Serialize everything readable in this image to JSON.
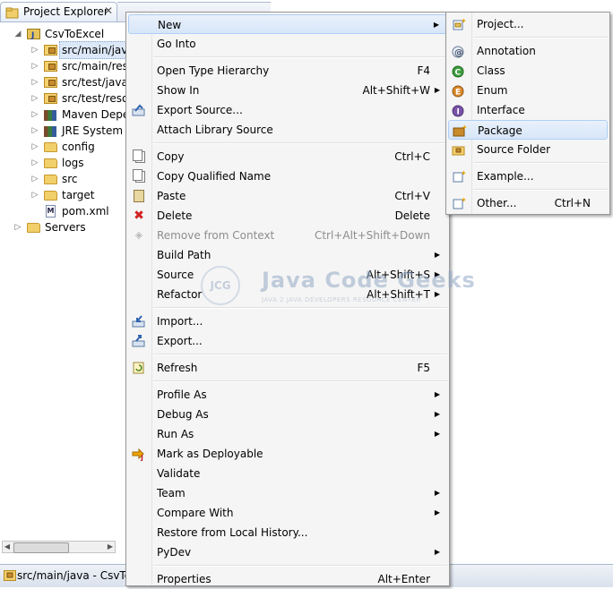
{
  "explorer": {
    "title": "Project Explorer",
    "close_glyph": "✕",
    "tree": [
      {
        "label": "CsvToExcel",
        "icon": "project-icon",
        "expanded": true
      },
      {
        "label": "src/main/java",
        "icon": "package-folder-icon",
        "selected": true
      },
      {
        "label": "src/main/resources",
        "icon": "package-folder-icon"
      },
      {
        "label": "src/test/java",
        "icon": "package-folder-icon"
      },
      {
        "label": "src/test/resources",
        "icon": "package-folder-icon"
      },
      {
        "label": "Maven Dependencies",
        "icon": "library-icon"
      },
      {
        "label": "JRE System Library",
        "icon": "library-icon"
      },
      {
        "label": "config",
        "icon": "folder-icon"
      },
      {
        "label": "logs",
        "icon": "folder-icon"
      },
      {
        "label": "src",
        "icon": "folder-icon"
      },
      {
        "label": "target",
        "icon": "folder-icon"
      },
      {
        "label": "pom.xml",
        "icon": "xml-file-icon"
      },
      {
        "label": "Servers",
        "icon": "folder-icon"
      }
    ]
  },
  "status_bar": {
    "text": "src/main/java - CsvToExcel"
  },
  "context_menu": {
    "items": [
      {
        "label": "New",
        "shortcut": "",
        "submenu": true,
        "highlighted": true
      },
      {
        "label": "Go Into",
        "shortcut": ""
      },
      {
        "label": "Open Type Hierarchy",
        "shortcut": "F4"
      },
      {
        "label": "Show In",
        "shortcut": "Alt+Shift+W",
        "submenu": true
      },
      {
        "label": "Export Source...",
        "shortcut": ""
      },
      {
        "label": "Attach Library Source",
        "shortcut": ""
      },
      {
        "label": "Copy",
        "shortcut": "Ctrl+C"
      },
      {
        "label": "Copy Qualified Name",
        "shortcut": ""
      },
      {
        "label": "Paste",
        "shortcut": "Ctrl+V"
      },
      {
        "label": "Delete",
        "shortcut": "Delete"
      },
      {
        "label": "Remove from Context",
        "shortcut": "Ctrl+Alt+Shift+Down",
        "disabled": true
      },
      {
        "label": "Build Path",
        "shortcut": "",
        "submenu": true
      },
      {
        "label": "Source",
        "shortcut": "Alt+Shift+S",
        "submenu": true
      },
      {
        "label": "Refactor",
        "shortcut": "Alt+Shift+T",
        "submenu": true
      },
      {
        "label": "Import...",
        "shortcut": ""
      },
      {
        "label": "Export...",
        "shortcut": ""
      },
      {
        "label": "Refresh",
        "shortcut": "F5"
      },
      {
        "label": "Profile As",
        "shortcut": "",
        "submenu": true
      },
      {
        "label": "Debug As",
        "shortcut": "",
        "submenu": true
      },
      {
        "label": "Run As",
        "shortcut": "",
        "submenu": true
      },
      {
        "label": "Mark as Deployable",
        "shortcut": ""
      },
      {
        "label": "Validate",
        "shortcut": ""
      },
      {
        "label": "Team",
        "shortcut": "",
        "submenu": true
      },
      {
        "label": "Compare With",
        "shortcut": "",
        "submenu": true
      },
      {
        "label": "Restore from Local History...",
        "shortcut": ""
      },
      {
        "label": "PyDev",
        "shortcut": "",
        "submenu": true
      },
      {
        "label": "Properties",
        "shortcut": "Alt+Enter"
      }
    ]
  },
  "new_submenu": {
    "items": [
      {
        "label": "Project...",
        "shortcut": ""
      },
      {
        "label": "Annotation",
        "shortcut": ""
      },
      {
        "label": "Class",
        "shortcut": ""
      },
      {
        "label": "Enum",
        "shortcut": ""
      },
      {
        "label": "Interface",
        "shortcut": ""
      },
      {
        "label": "Package",
        "shortcut": "",
        "highlighted": true
      },
      {
        "label": "Source Folder",
        "shortcut": ""
      },
      {
        "label": "Example...",
        "shortcut": ""
      },
      {
        "label": "Other...",
        "shortcut": "Ctrl+N"
      }
    ]
  },
  "watermark": {
    "logo_text": "JCG",
    "name": "Java Code Geeks",
    "tagline": "JAVA 2 JAVA DEVELOPERS RESOURCE CENTER"
  },
  "glyphs": {
    "submenu_arrow": "▶",
    "expand": "▷",
    "collapse": "◢"
  },
  "colors": {
    "highlight_border": "#aecff7",
    "menu_bg": "#f5f5f5",
    "disabled_text": "#8d8d8d"
  }
}
